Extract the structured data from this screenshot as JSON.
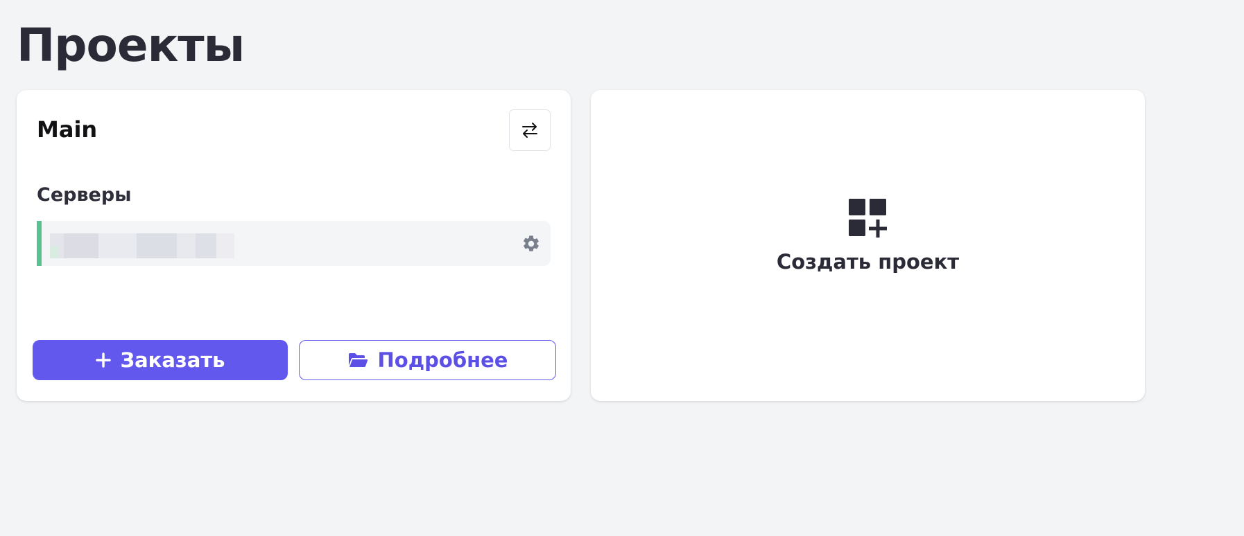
{
  "page": {
    "title": "Проекты"
  },
  "project": {
    "name": "Main",
    "servers_heading": "Серверы",
    "servers": [
      {
        "name_redacted": true,
        "status_color": "#58c290"
      }
    ],
    "actions": {
      "order_label": "Заказать",
      "details_label": "Подробнее"
    }
  },
  "create_project": {
    "label": "Создать проект"
  },
  "colors": {
    "accent": "#6358ee",
    "status_ok": "#58c290",
    "background": "#f3f4f6"
  },
  "icons": [
    "swap-icon",
    "gear-icon",
    "plus-icon",
    "folder-open-icon",
    "grid-plus-icon"
  ]
}
